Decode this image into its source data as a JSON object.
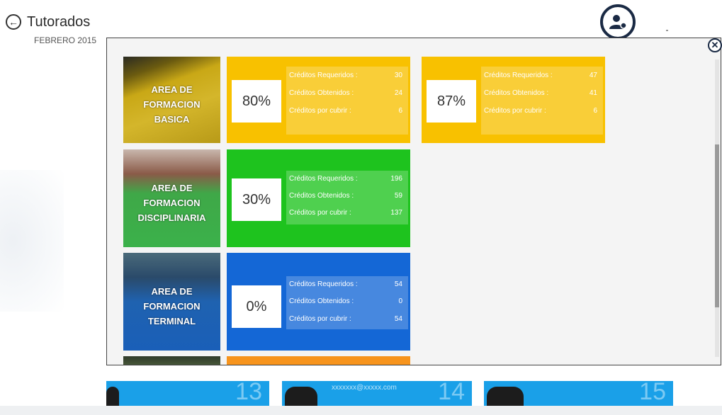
{
  "header": {
    "title": "Tutorados",
    "subtitle": "FEBRERO 2015",
    "back_icon": "back-arrow-icon",
    "user_icon": "user-add-icon"
  },
  "modal": {
    "close_icon": "close-icon"
  },
  "areas": [
    {
      "image_label": [
        "AREA DE",
        "FORMACION",
        "BASICA"
      ],
      "tiles": [
        {
          "percent": "80%",
          "color": "#f8c100",
          "stats": [
            {
              "label": "Créditos Requeridos :",
              "value": "30"
            },
            {
              "label": "Créditos Obtenidos :",
              "value": "24"
            },
            {
              "label": "Créditos por cubrir :",
              "value": "6"
            }
          ]
        },
        {
          "percent": "87%",
          "color": "#f8c100",
          "stats": [
            {
              "label": "Créditos Requeridos :",
              "value": "47"
            },
            {
              "label": "Créditos Obtenidos :",
              "value": "41"
            },
            {
              "label": "Créditos por cubrir :",
              "value": "6"
            }
          ]
        }
      ]
    },
    {
      "image_label": [
        "AREA DE",
        "FORMACION",
        "DISCIPLINARIA"
      ],
      "tiles": [
        {
          "percent": "30%",
          "color": "#1ec31e",
          "stats": [
            {
              "label": "Créditos Requeridos :",
              "value": "196"
            },
            {
              "label": "Créditos Obtenidos :",
              "value": "59"
            },
            {
              "label": "Créditos por cubrir :",
              "value": "137"
            }
          ]
        }
      ]
    },
    {
      "image_label": [
        "AREA DE",
        "FORMACION",
        "TERMINAL"
      ],
      "tiles": [
        {
          "percent": "0%",
          "color": "#1467d6",
          "stats": [
            {
              "label": "Créditos Requeridos :",
              "value": "54"
            },
            {
              "label": "Créditos Obtenidos :",
              "value": "0"
            },
            {
              "label": "Créditos por cubrir :",
              "value": "54"
            }
          ]
        }
      ]
    }
  ],
  "partial_tile_color": "#f7941d",
  "bottom_cards": [
    {
      "number": "13",
      "email": ""
    },
    {
      "number": "14",
      "email": "xxxxxxx@xxxxx.com"
    },
    {
      "number": "15",
      "email": ""
    }
  ]
}
